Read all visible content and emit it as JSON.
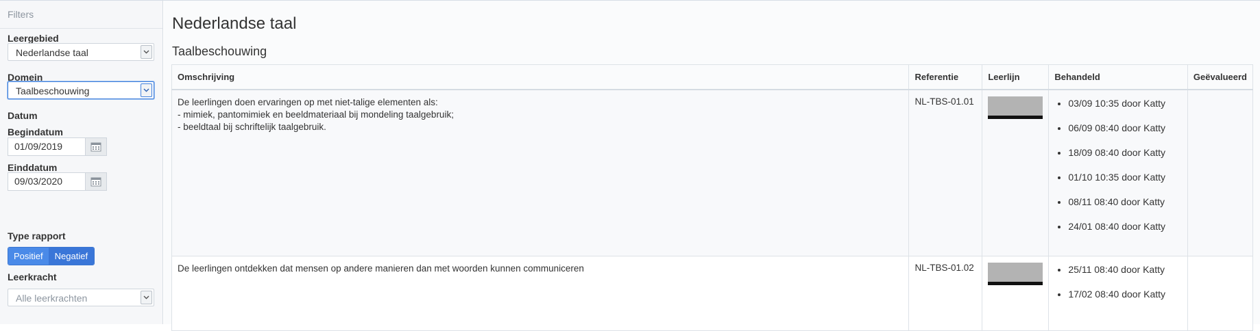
{
  "sidebar": {
    "header": "Filters",
    "leergebied": {
      "label": "Leergebied",
      "value": "Nederlandse taal"
    },
    "domein": {
      "label": "Domein",
      "value": "Taalbeschouwing"
    },
    "datum": {
      "label": "Datum"
    },
    "begindatum": {
      "label": "Begindatum",
      "value": "01/09/2019"
    },
    "einddatum": {
      "label": "Einddatum",
      "value": "09/03/2020"
    },
    "type_rapport": {
      "label": "Type rapport",
      "options": [
        "Positief",
        "Negatief"
      ]
    },
    "leerkracht": {
      "label": "Leerkracht",
      "placeholder": "Alle leerkrachten"
    }
  },
  "main": {
    "title": "Nederlandse taal",
    "section": "Taalbeschouwing",
    "table": {
      "headers": [
        "Omschrijving",
        "Referentie",
        "Leerlijn",
        "Behandeld",
        "Geëvalueerd"
      ],
      "rows": [
        {
          "description": [
            "De leerlingen doen ervaringen op met niet-talige elementen als:",
            "- mimiek, pantomimiek en beeldmateriaal bij mondeling taalgebruik;",
            "- beeldtaal bij schriftelijk taalgebruik."
          ],
          "referentie": "NL-TBS-01.01",
          "behandeld": [
            "03/09 10:35 door Katty",
            "06/09 08:40 door Katty",
            "18/09 08:40 door Katty",
            "01/10 10:35 door Katty",
            "08/11 08:40 door Katty",
            "24/01 08:40 door Katty"
          ],
          "geevalueerd": ""
        },
        {
          "description": [
            "De leerlingen ontdekken dat mensen op andere manieren dan met woorden kunnen communiceren"
          ],
          "referentie": "NL-TBS-01.02",
          "behandeld": [
            "25/11 08:40 door Katty",
            "17/02 08:40 door Katty"
          ],
          "geevalueerd": ""
        }
      ]
    }
  },
  "colors": {
    "accent": "#4a8ae8",
    "focus_border": "#3f7fdc",
    "sidebar_bg": "#f6f7f9"
  },
  "icons": {
    "select_arrow": "chevron-down-icon",
    "date_picker": "calendar-icon"
  }
}
